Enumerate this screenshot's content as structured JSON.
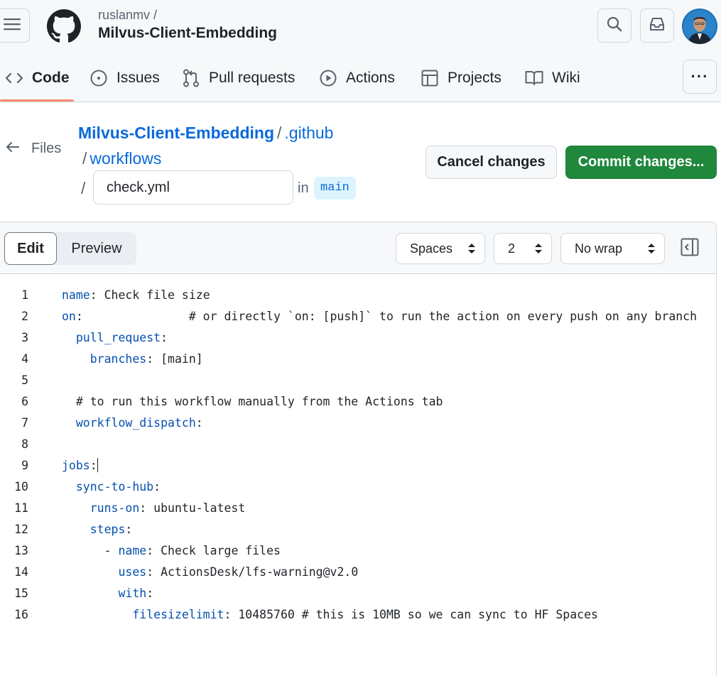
{
  "header": {
    "owner": "ruslanmv /",
    "repo_name": "Milvus-Client-Embedding"
  },
  "nav": {
    "tabs": [
      {
        "label": "Code",
        "icon": "code-icon"
      },
      {
        "label": "Issues",
        "icon": "issue-opened-icon"
      },
      {
        "label": "Pull requests",
        "icon": "git-pull-request-icon"
      },
      {
        "label": "Actions",
        "icon": "play-icon"
      },
      {
        "label": "Projects",
        "icon": "table-icon"
      },
      {
        "label": "Wiki",
        "icon": "book-icon"
      }
    ],
    "active": "Code",
    "more": "···"
  },
  "breadcrumb": {
    "files_label": "Files",
    "repo": "Milvus-Client-Embedding",
    "folder1": ".github",
    "folder2": "workflows",
    "sep": "/",
    "filename": "check.yml",
    "in_label": "in",
    "branch": "main"
  },
  "actions": {
    "cancel": "Cancel changes",
    "commit": "Commit changes..."
  },
  "editor": {
    "tabs": {
      "edit": "Edit",
      "preview": "Preview",
      "selected": "Edit"
    },
    "indent_mode": "Spaces",
    "indent_size": "2",
    "wrap_mode": "No wrap",
    "lines": [
      {
        "n": "1",
        "indent": "",
        "key": "name",
        "rest": ": Check file size"
      },
      {
        "n": "2",
        "indent": "",
        "key": "on",
        "rest": ":               # or directly `on: [push]` to run the action on every push on any branch"
      },
      {
        "n": "3",
        "indent": "  ",
        "key": "pull_request",
        "rest": ":"
      },
      {
        "n": "4",
        "indent": "    ",
        "key": "branches",
        "rest": ": [main]"
      },
      {
        "n": "5",
        "indent": "",
        "key": "",
        "rest": ""
      },
      {
        "n": "6",
        "indent": "  ",
        "key": "",
        "rest": "# to run this workflow manually from the Actions tab"
      },
      {
        "n": "7",
        "indent": "  ",
        "key": "workflow_dispatch",
        "rest": ":"
      },
      {
        "n": "8",
        "indent": "",
        "key": "",
        "rest": ""
      },
      {
        "n": "9",
        "indent": "",
        "key": "jobs",
        "rest": ":"
      },
      {
        "n": "10",
        "indent": "  ",
        "key": "sync-to-hub",
        "rest": ":"
      },
      {
        "n": "11",
        "indent": "    ",
        "key": "runs-on",
        "rest": ": ubuntu-latest"
      },
      {
        "n": "12",
        "indent": "    ",
        "key": "steps",
        "rest": ":"
      },
      {
        "n": "13",
        "indent": "      - ",
        "key": "name",
        "rest": ": Check large files"
      },
      {
        "n": "14",
        "indent": "        ",
        "key": "uses",
        "rest": ": ActionsDesk/lfs-warning@v2.0"
      },
      {
        "n": "15",
        "indent": "        ",
        "key": "with",
        "rest": ":"
      },
      {
        "n": "16",
        "indent": "          ",
        "key": "filesizelimit",
        "rest": ": 10485760 # this is 10MB so we can sync to HF Spaces"
      }
    ],
    "cursor_line": "9"
  }
}
